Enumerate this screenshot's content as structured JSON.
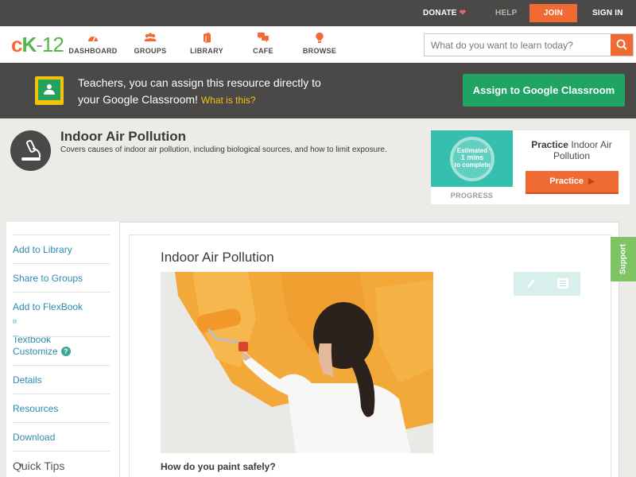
{
  "topbar": {
    "donate": "DONATE",
    "help": "HELP",
    "join": "JOIN",
    "signin": "SIGN IN"
  },
  "nav": {
    "logo": {
      "c": "c",
      "k": "K",
      "dash": "-",
      "num": "12"
    },
    "items": [
      {
        "label": "DASHBOARD",
        "icon": "dashboard-icon"
      },
      {
        "label": "GROUPS",
        "icon": "groups-icon"
      },
      {
        "label": "LIBRARY",
        "icon": "library-icon"
      },
      {
        "label": "CAFE",
        "icon": "cafe-icon"
      },
      {
        "label": "BROWSE",
        "icon": "browse-icon"
      }
    ],
    "search_placeholder": "What do you want to learn today?"
  },
  "banner": {
    "line1": "Teachers, you can assign this resource directly to",
    "line2": "your Google Classroom!",
    "what": "What is this?",
    "assign_button": "Assign to Google Classroom"
  },
  "header": {
    "title": "Indoor Air Pollution",
    "description": "Covers causes of indoor air pollution, including biological sources, and how to limit exposure."
  },
  "practice": {
    "ring_line1": "Estimated",
    "ring_line2": "1 mins",
    "ring_line3": "to complete",
    "progress_label": "PROGRESS",
    "title_bold": "Practice",
    "title_rest": "Indoor Air Pollution",
    "button": "Practice"
  },
  "sidebar": {
    "add_library": "Add to Library",
    "share_groups": "Share to Groups",
    "add_flexbook": "Add to FlexBook",
    "reg": "®",
    "textbook": "Textbook",
    "customize": "Customize",
    "details": "Details",
    "resources": "Resources",
    "download": "Download",
    "quick_tips": "Quick Tips"
  },
  "article": {
    "title": "Indoor Air Pollution",
    "question": "How do you paint safely?"
  },
  "support": "Support",
  "colors": {
    "accent_orange": "#f06b33",
    "brand_green": "#53b848",
    "classroom_green": "#1fa463",
    "link_blue": "#2e8bb0",
    "dark_bar": "#4a4947"
  }
}
